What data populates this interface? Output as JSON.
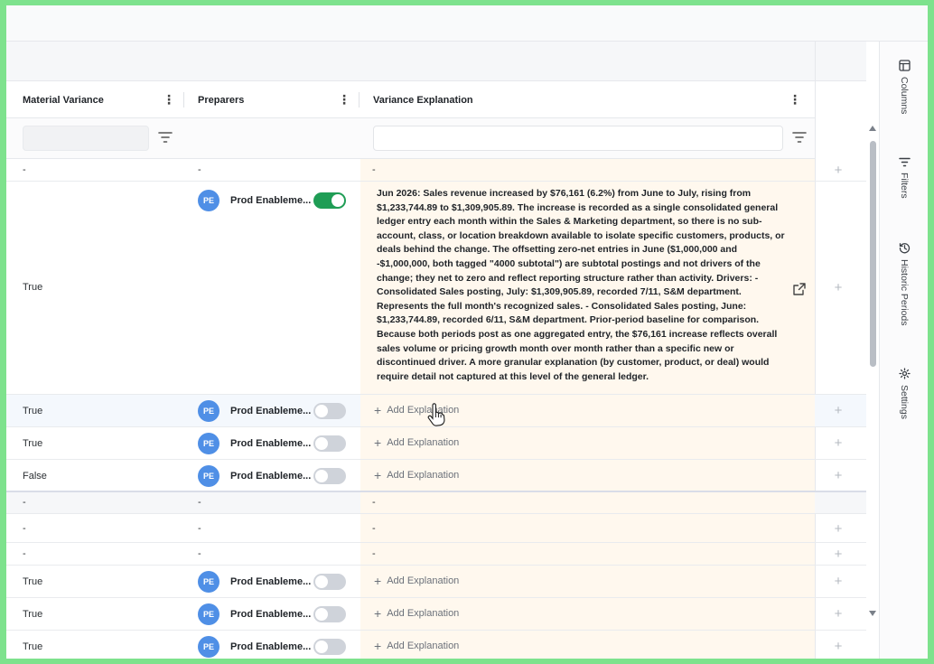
{
  "columns": {
    "material_variance": "Material Variance",
    "preparers": "Preparers",
    "variance_explanation": "Variance Explanation"
  },
  "sidebar": {
    "columns": "Columns",
    "filters": "Filters",
    "historic_periods": "Historic Periods",
    "settings": "Settings"
  },
  "dash": "-",
  "add_explanation": "Add Explanation",
  "preparer": {
    "initials": "PE",
    "name": "Prod Enableme..."
  },
  "rows": [
    {
      "variance": "-",
      "prep": "-",
      "expl": "-"
    },
    {
      "variance": "True",
      "toggle": "on",
      "explanation": "Jun 2026: Sales revenue increased by $76,161 (6.2%) from June to July, rising from $1,233,744.89 to $1,309,905.89. The increase is recorded as a single consolidated general ledger entry each month within the Sales & Marketing department, so there is no sub-account, class, or location breakdown available to isolate specific customers, products, or deals behind the change. The offsetting zero-net entries in June ($1,000,000 and -$1,000,000, both tagged \"4000 subtotal\") are subtotal postings and not drivers of the change; they net to zero and reflect reporting structure rather than activity. Drivers: - Consolidated Sales posting, July: $1,309,905.89, recorded 7/11, S&M department. Represents the full month's recognized sales. - Consolidated Sales posting, June: $1,233,744.89, recorded 6/11, S&M department. Prior-period baseline for comparison. Because both periods post as one aggregated entry, the $76,161 increase reflects overall sales volume or pricing growth month over month rather than a specific new or discontinued driver. A more granular explanation (by customer, product, or deal) would require detail not captured at this level of the general ledger."
    },
    {
      "variance": "True",
      "toggle": "off"
    },
    {
      "variance": "True",
      "toggle": "off"
    },
    {
      "variance": "False",
      "toggle": "off"
    },
    {
      "variance": "-",
      "prep": "-",
      "expl": "-"
    },
    {
      "variance": "-",
      "prep": "-",
      "expl": "-"
    },
    {
      "variance": "-",
      "prep": "-",
      "expl": "-"
    },
    {
      "variance": "True",
      "toggle": "off"
    },
    {
      "variance": "True",
      "toggle": "off"
    },
    {
      "variance": "True",
      "toggle": "off"
    }
  ],
  "colors": {
    "accent_green": "#1f9d55",
    "avatar_blue": "#4f8fe6",
    "explanation_bg": "#fff8ee",
    "frame_border": "#7ee28d"
  }
}
